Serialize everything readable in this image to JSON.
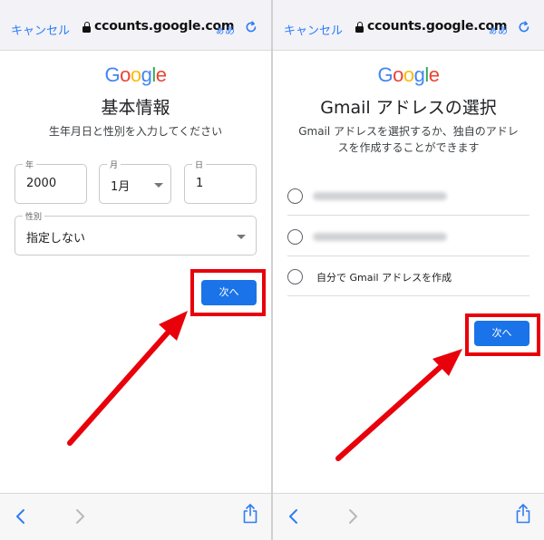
{
  "browser": {
    "cancel_label": "キャンセル",
    "url": "ccounts.google.com",
    "text_size_label": "ぁあ"
  },
  "left_panel": {
    "logo_text": "Google",
    "title": "基本情報",
    "subtitle": "生年月日と性別を入力してください",
    "year": {
      "label": "年",
      "value": "2000"
    },
    "month": {
      "label": "月",
      "value": "1月"
    },
    "day": {
      "label": "日",
      "value": "1"
    },
    "gender": {
      "label": "性別",
      "value": "指定しない"
    },
    "next_label": "次へ"
  },
  "right_panel": {
    "logo_text": "Google",
    "title": "Gmail アドレスの選択",
    "subtitle_line1": "Gmail アドレスを選択するか、独自のアドレ",
    "subtitle_line2": "スを作成することができます",
    "options": [
      {
        "label": ""
      },
      {
        "label": ""
      },
      {
        "label": "自分で Gmail アドレスを作成"
      }
    ],
    "next_label": "次へ"
  },
  "colors": {
    "accent_blue": "#1a73e8",
    "highlight_red": "#e8000b",
    "safari_blue": "#2f7cf6"
  },
  "icons": [
    "lock-icon",
    "reload-icon",
    "back-chevron-icon",
    "forward-chevron-icon",
    "share-icon",
    "caret-down-icon",
    "red-arrow"
  ]
}
